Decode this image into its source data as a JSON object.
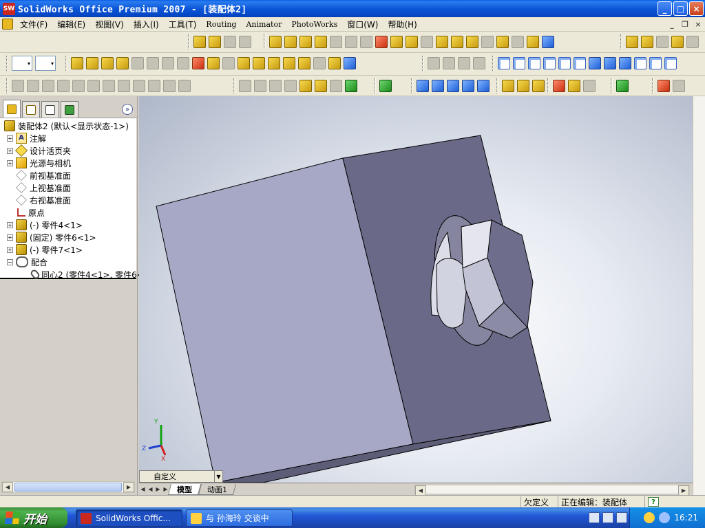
{
  "window": {
    "title": "SolidWorks Office Premium 2007 - [装配体2]",
    "app_icon_text": "SW",
    "minimize": "_",
    "maximize": "□",
    "close": "×"
  },
  "menu": {
    "items": [
      {
        "label": "文件(F)"
      },
      {
        "label": "编辑(E)"
      },
      {
        "label": "视图(V)"
      },
      {
        "label": "插入(I)"
      },
      {
        "label": "工具(T)"
      },
      {
        "label": "Routing"
      },
      {
        "label": "Animator"
      },
      {
        "label": "PhotoWorks"
      },
      {
        "label": "窗口(W)"
      },
      {
        "label": "帮助(H)"
      }
    ],
    "mdi_minimize": "_",
    "mdi_restore": "❐",
    "mdi_close": "×"
  },
  "feature_tree": {
    "expand_symbol": "»",
    "root": "装配体2  (默认<显示状态-1>)",
    "items": [
      {
        "label": "注解",
        "icon": "annotation-icon"
      },
      {
        "label": "设计活页夹",
        "icon": "design-binder-icon"
      },
      {
        "label": "光源与相机",
        "icon": "lights-cameras-icon"
      },
      {
        "label": "前视基准面",
        "icon": "plane-icon"
      },
      {
        "label": "上视基准面",
        "icon": "plane-icon"
      },
      {
        "label": "右视基准面",
        "icon": "plane-icon"
      },
      {
        "label": "原点",
        "icon": "origin-icon"
      },
      {
        "label": "(-) 零件4<1>",
        "icon": "part-icon"
      },
      {
        "label": "(固定) 零件6<1>",
        "icon": "part-icon"
      },
      {
        "label": "(-) 零件7<1>",
        "icon": "part-icon"
      },
      {
        "label": "配合",
        "icon": "mates-icon"
      },
      {
        "label": "同心2 (零件4<1>, 零件6<",
        "icon": "concentric-mate-icon"
      }
    ],
    "annotation_letter": "A"
  },
  "viewport": {
    "triad": {
      "x": "X",
      "y": "Y",
      "z": "Z"
    },
    "configuration": "自定义",
    "tabs": [
      {
        "label": "模型"
      },
      {
        "label": "动画1"
      }
    ]
  },
  "statusbar": {
    "status": "欠定义",
    "editing": "正在编辑：装配体",
    "help": "?"
  },
  "taskbar": {
    "start": "开始",
    "tasks": [
      {
        "label": "SolidWorks Offic..."
      },
      {
        "label": "与 孙海玲 交谈中"
      }
    ],
    "clock": "16:21"
  }
}
